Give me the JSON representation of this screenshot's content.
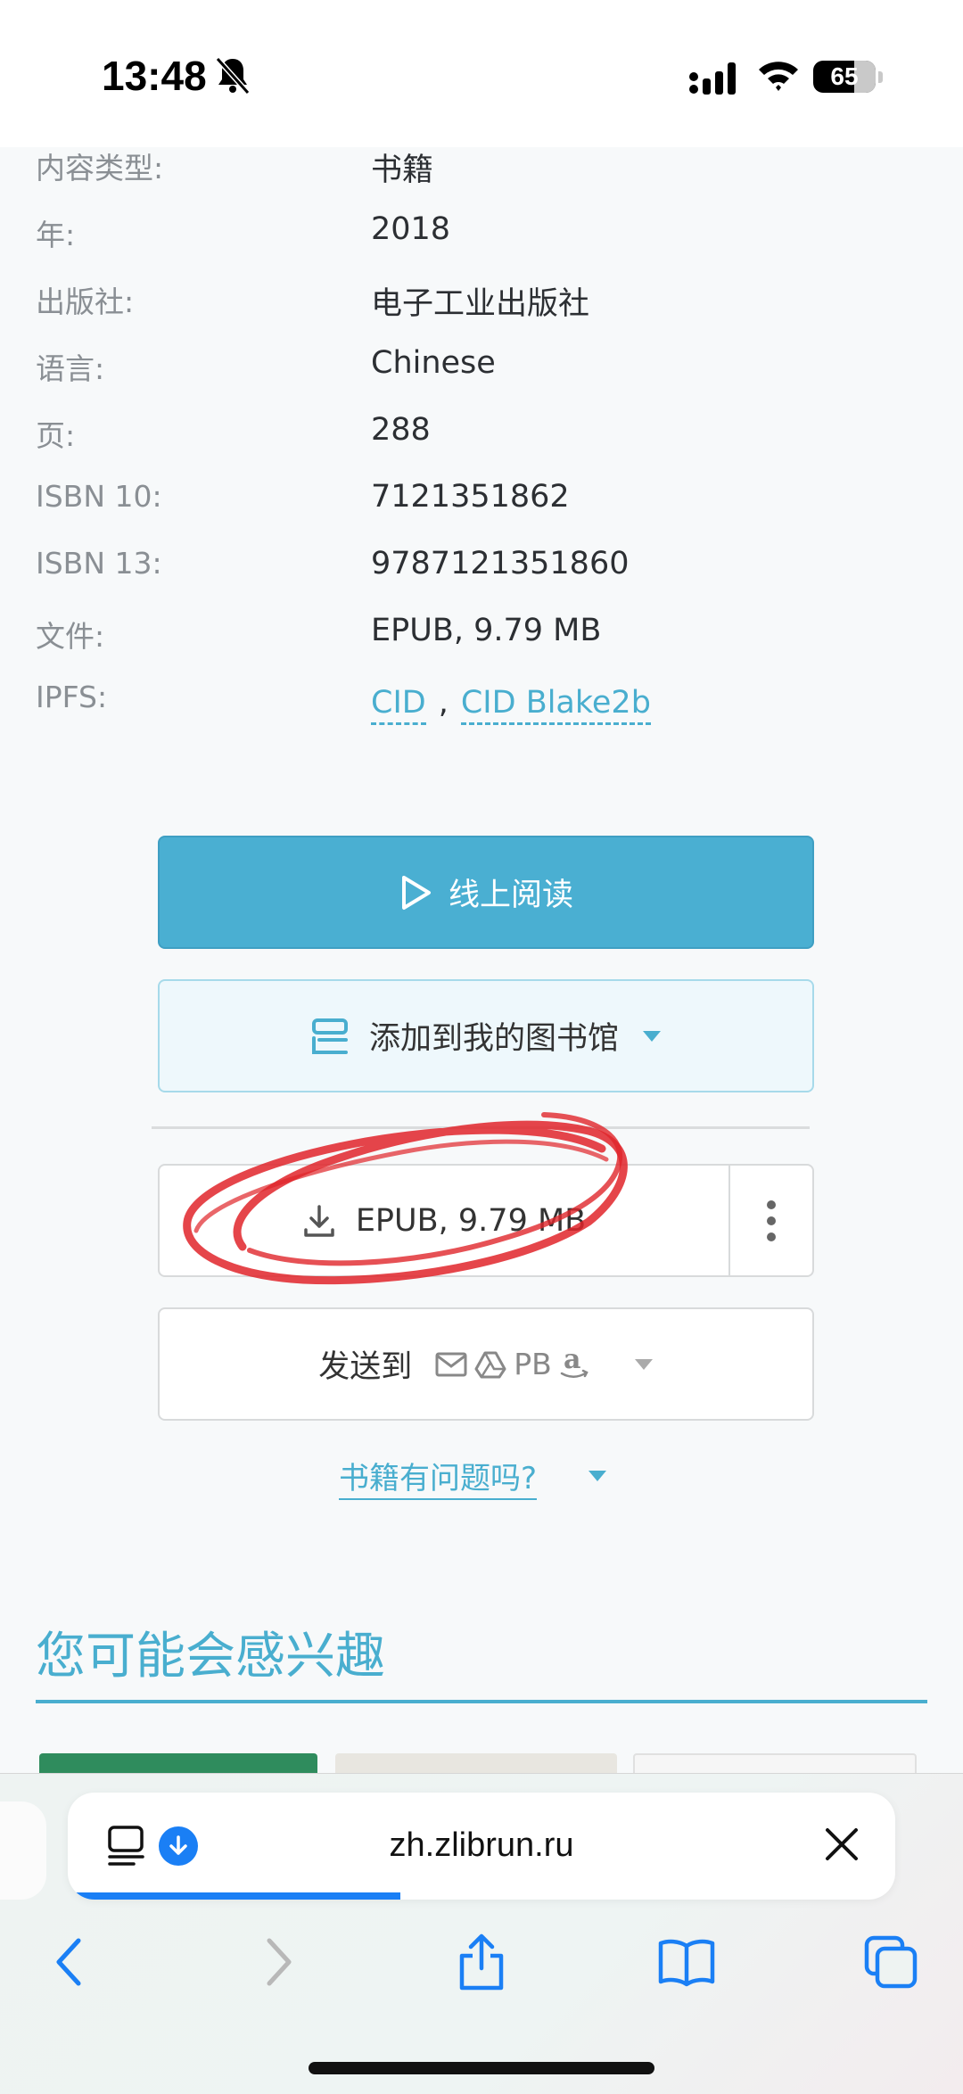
{
  "status_bar": {
    "time": "13:48",
    "battery_text": "65",
    "battery_level": 0.65,
    "icons": [
      "bell-slash-icon",
      "signal-icon",
      "wifi-icon",
      "battery-icon"
    ]
  },
  "details": [
    {
      "label": "内容类型:",
      "value": "书籍"
    },
    {
      "label": "年:",
      "value": "2018"
    },
    {
      "label": "出版社:",
      "value": "电子工业出版社"
    },
    {
      "label": "语言:",
      "value": "Chinese"
    },
    {
      "label": "页:",
      "value": "288"
    },
    {
      "label": "ISBN 10:",
      "value": "7121351862"
    },
    {
      "label": "ISBN 13:",
      "value": "9787121351860"
    },
    {
      "label": "文件:",
      "value": "EPUB, 9.79 MB"
    }
  ],
  "ipfs": {
    "label": "IPFS:",
    "link1": "CID",
    "separator": ",",
    "link2": "CID Blake2b"
  },
  "actions": {
    "read_online": "线上阅读",
    "add_to_library": "添加到我的图书馆",
    "download": "EPUB, 9.79 MB",
    "send_to": "发送到",
    "send_targets_text": "PB",
    "send_target_icons": [
      "mail-icon",
      "google-drive-icon",
      "pocketbook-icon",
      "amazon-icon"
    ],
    "problem_link": "书籍有问题吗?"
  },
  "section": {
    "title": "您可能会感兴趣"
  },
  "browser": {
    "url": "zh.zlibrun.ru",
    "load_progress": 0.3
  },
  "colors": {
    "accent": "#49aecf",
    "read_button": "#4aafd2",
    "annotation": "#e0252a",
    "browser_blue": "#1a7ff5"
  }
}
